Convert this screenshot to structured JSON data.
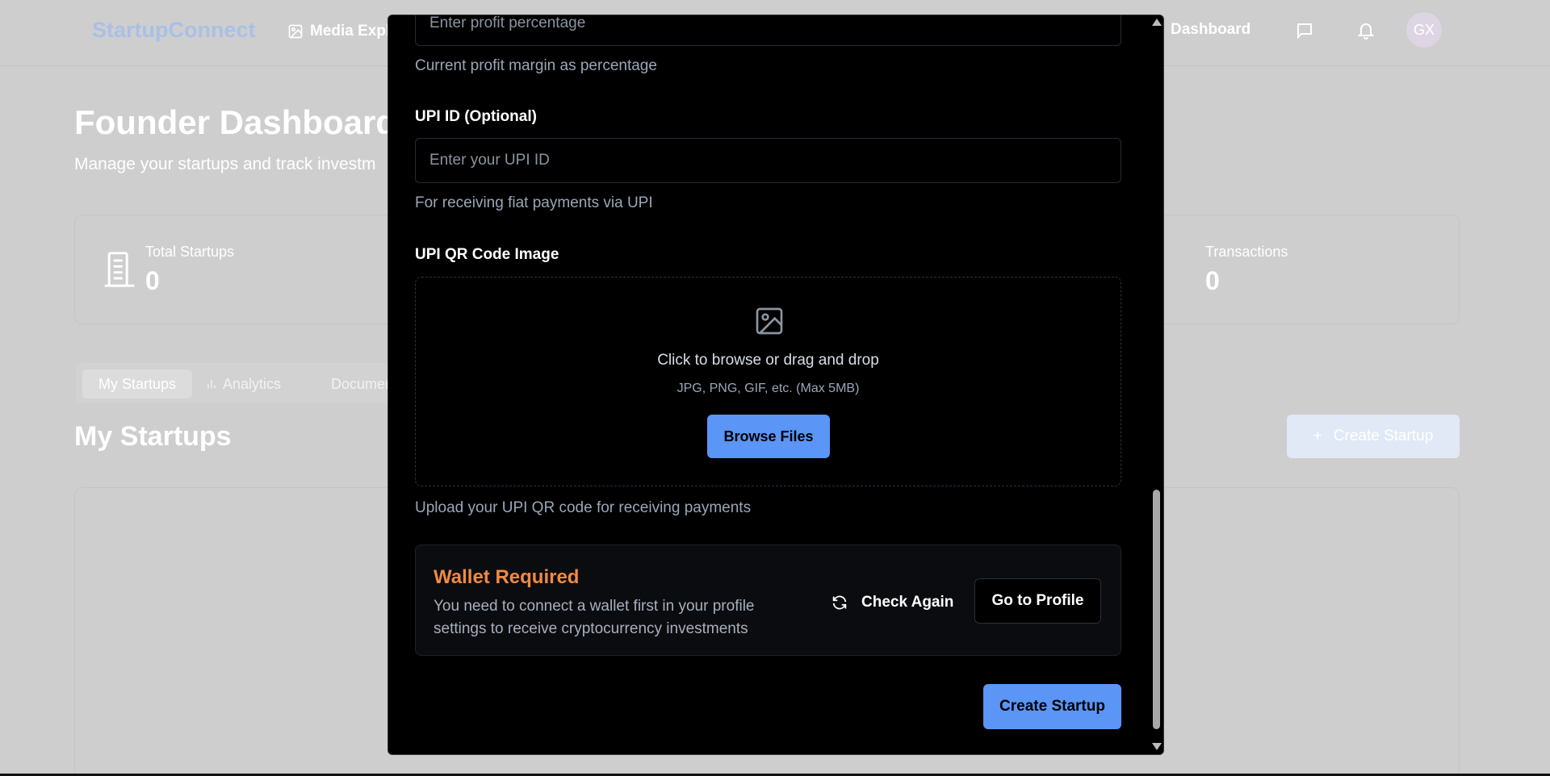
{
  "background": {
    "brand": "StartupConnect",
    "nav": {
      "media_label": "Media Expl",
      "dashboard_label": "Dashboard",
      "avatar_initials": "GX"
    },
    "title": "Founder Dashboard",
    "subtitle": "Manage your startups and track investm",
    "stats": [
      {
        "label": "Total Startups",
        "value": "0"
      },
      {
        "label": "Transactions",
        "value": "0"
      }
    ],
    "tabs": [
      {
        "label": "My Startups",
        "active": true
      },
      {
        "label": "Analytics",
        "active": false
      },
      {
        "label": "Document",
        "active": false
      }
    ],
    "section_title": "My Startups",
    "create_button": "Create Startup"
  },
  "modal": {
    "profit": {
      "placeholder": "Enter profit percentage",
      "help": "Current profit margin as percentage"
    },
    "upi_id": {
      "label": "UPI ID (Optional)",
      "placeholder": "Enter your UPI ID",
      "help": "For receiving fiat payments via UPI"
    },
    "upi_qr": {
      "label": "UPI QR Code Image",
      "drop_title": "Click to browse or drag and drop",
      "drop_sub": "JPG, PNG, GIF, etc. (Max 5MB)",
      "browse_button": "Browse Files",
      "help": "Upload your UPI QR code for receiving payments"
    },
    "wallet": {
      "title": "Wallet Required",
      "description": "You need to connect a wallet first in your profile settings to receive cryptocurrency investments",
      "check_again": "Check Again",
      "goto_profile": "Go to Profile"
    },
    "submit_button": "Create Startup"
  },
  "colors": {
    "accent": "#5b95f5",
    "warning": "#ef8a45",
    "modal_bg": "#000000"
  }
}
